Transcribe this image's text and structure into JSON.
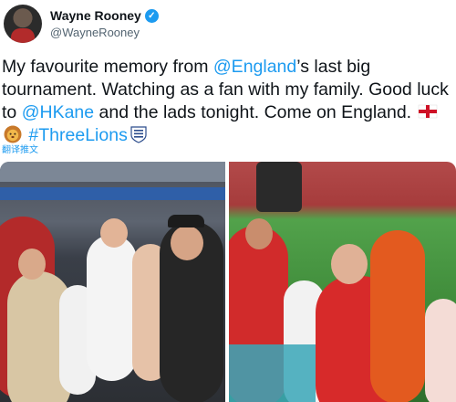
{
  "tweet": {
    "author": {
      "display_name": "Wayne Rooney",
      "handle": "@WayneRooney",
      "verified": true,
      "avatar_icon": "avatar-photo"
    },
    "text": {
      "part1": "My favourite memory from ",
      "mention1": "@England",
      "part2": "’s last big tournament. Watching as a fan with my family. Good luck to ",
      "mention2": "@HKane",
      "part3": " and the lads tonight. Come on England. ",
      "hashtag": "#ThreeLions",
      "emojis": [
        "england-flag-icon",
        "lion-face-icon",
        "three-lions-crest-icon"
      ]
    },
    "translate_label": "翻译推文",
    "media": {
      "count": 2,
      "items": [
        "photo-family-in-stands",
        "photo-boys-with-england-player"
      ]
    },
    "colors": {
      "link": "#1d9bf0",
      "verified": "#1d9bf0",
      "text": "#0f1419",
      "secondary": "#536471"
    }
  }
}
